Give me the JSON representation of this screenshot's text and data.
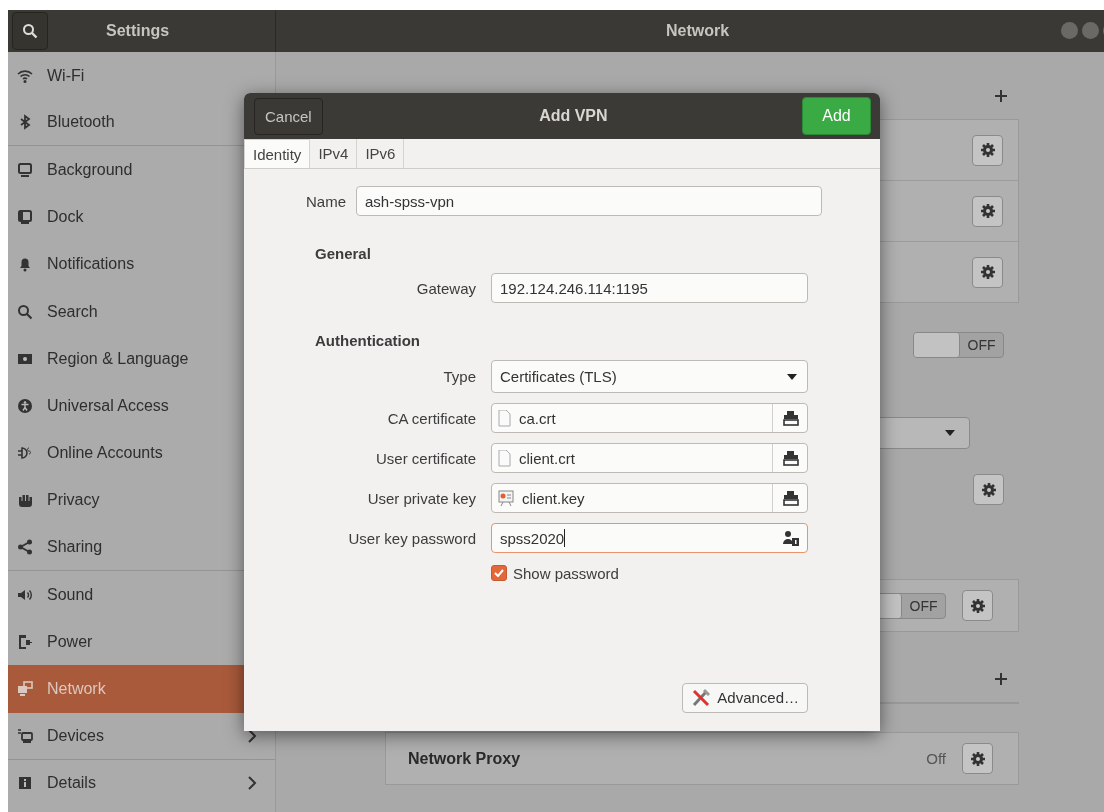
{
  "window": {
    "sidebar_title": "Settings",
    "title": "Network"
  },
  "sidebar": {
    "items": [
      {
        "label": "Wi-Fi",
        "selected": false,
        "separator_after": false
      },
      {
        "label": "Bluetooth",
        "selected": false,
        "separator_after": true
      },
      {
        "label": "Background",
        "selected": false,
        "separator_after": false
      },
      {
        "label": "Dock",
        "selected": false,
        "separator_after": false
      },
      {
        "label": "Notifications",
        "selected": false,
        "separator_after": false
      },
      {
        "label": "Search",
        "selected": false,
        "separator_after": false
      },
      {
        "label": "Region & Language",
        "selected": false,
        "separator_after": false
      },
      {
        "label": "Universal Access",
        "selected": false,
        "separator_after": false
      },
      {
        "label": "Online Accounts",
        "selected": false,
        "separator_after": false
      },
      {
        "label": "Privacy",
        "selected": false,
        "separator_after": false
      },
      {
        "label": "Sharing",
        "selected": false,
        "separator_after": true
      },
      {
        "label": "Sound",
        "selected": false,
        "separator_after": false
      },
      {
        "label": "Power",
        "selected": false,
        "separator_after": false
      },
      {
        "label": "Network",
        "selected": true,
        "separator_after": false
      },
      {
        "label": "Devices",
        "selected": false,
        "submenu": true,
        "separator_after": true
      },
      {
        "label": "Details",
        "selected": false,
        "submenu": true,
        "separator_after": false
      }
    ]
  },
  "network_panel": {
    "vpn_switch": {
      "on": false,
      "label": "OFF"
    },
    "proxy_switch": {
      "on": false,
      "label": "OFF"
    },
    "network_proxy": {
      "label": "Network Proxy",
      "status": "Off"
    }
  },
  "dialog": {
    "title": "Add VPN",
    "cancel": "Cancel",
    "confirm": "Add",
    "tabs": [
      {
        "label": "Identity",
        "selected": true
      },
      {
        "label": "IPv4",
        "selected": false
      },
      {
        "label": "IPv6",
        "selected": false
      }
    ],
    "name": {
      "label": "Name",
      "value": "ash-spss-vpn"
    },
    "sections": [
      {
        "heading": "General",
        "fields": [
          {
            "kind": "entry",
            "label": "Gateway",
            "value": "192.124.246.114:1195"
          }
        ]
      },
      {
        "heading": "Authentication",
        "fields": [
          {
            "kind": "combo",
            "label": "Type",
            "value": "Certificates (TLS)"
          },
          {
            "kind": "file",
            "label": "CA certificate",
            "value": "ca.crt"
          },
          {
            "kind": "file",
            "label": "User certificate",
            "value": "client.crt"
          },
          {
            "kind": "keyfile",
            "label": "User private key",
            "value": "client.key"
          },
          {
            "kind": "password",
            "label": "User key password",
            "value": "spss2020",
            "focused": true
          }
        ]
      }
    ],
    "show_password": {
      "label": "Show password",
      "checked": true
    },
    "advanced": "Advanced…"
  }
}
